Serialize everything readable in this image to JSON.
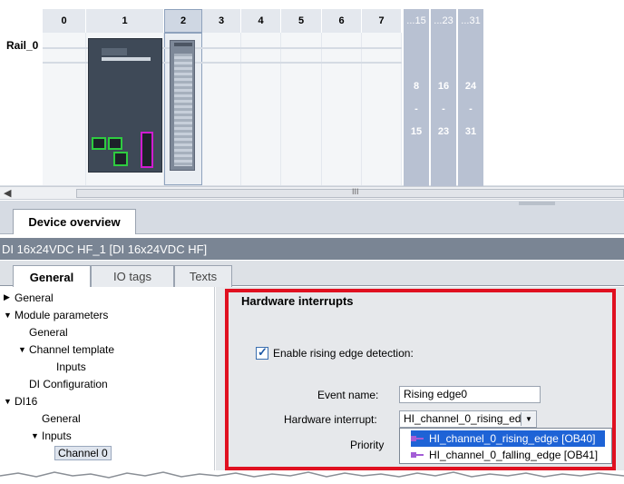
{
  "rack": {
    "rail_label": "Rail_0",
    "slots": [
      "0",
      "1",
      "2",
      "3",
      "4",
      "5",
      "6",
      "7"
    ],
    "selected_slot": "2",
    "group_headers": [
      "...15",
      "...23",
      "...31"
    ],
    "group_columns": [
      {
        "top": "8",
        "bottom": "15"
      },
      {
        "top": "16",
        "bottom": "23"
      },
      {
        "top": "24",
        "bottom": "31"
      }
    ],
    "group_separator": "-",
    "scroll_marker": "III"
  },
  "tabs": {
    "device_overview": "Device overview"
  },
  "module": {
    "title": "DI 16x24VDC HF_1 [DI 16x24VDC HF]"
  },
  "property_tabs": [
    {
      "label": "General",
      "active": true
    },
    {
      "label": "IO tags",
      "active": false
    },
    {
      "label": "Texts",
      "active": false
    }
  ],
  "nav": [
    {
      "label": "General",
      "indent": 0,
      "arrow": "▶"
    },
    {
      "label": "Module parameters",
      "indent": 0,
      "arrow": "▼"
    },
    {
      "label": "General",
      "indent": 1,
      "arrow": ""
    },
    {
      "label": "Channel template",
      "indent": 1,
      "arrow": "▼"
    },
    {
      "label": "Inputs",
      "indent": 2,
      "arrow": ""
    },
    {
      "label": "DI Configuration",
      "indent": 1,
      "arrow": ""
    },
    {
      "label": "DI16",
      "indent": 0,
      "arrow": "▼"
    },
    {
      "label": "General",
      "indent": 1,
      "arrow": ""
    },
    {
      "label": "Inputs",
      "indent": 1,
      "arrow": "▼"
    },
    {
      "label": "Channel 0",
      "indent": 2,
      "arrow": "",
      "selected": true
    }
  ],
  "content": {
    "section_title": "Hardware interrupts",
    "checkbox_label": "Enable rising edge detection:",
    "checkbox_checked": true,
    "event_name_label": "Event name:",
    "event_name_value": "Rising edge0",
    "hw_interrupt_label": "Hardware interrupt:",
    "hw_interrupt_value": "HI_channel_0_rising_edge",
    "priority_label": "Priority",
    "dropdown_options": [
      {
        "label": "HI_channel_0_rising_edge [OB40]",
        "selected": true
      },
      {
        "label": "HI_channel_0_falling_edge [OB41]",
        "selected": false
      }
    ],
    "highlight_color": "#e01020"
  }
}
